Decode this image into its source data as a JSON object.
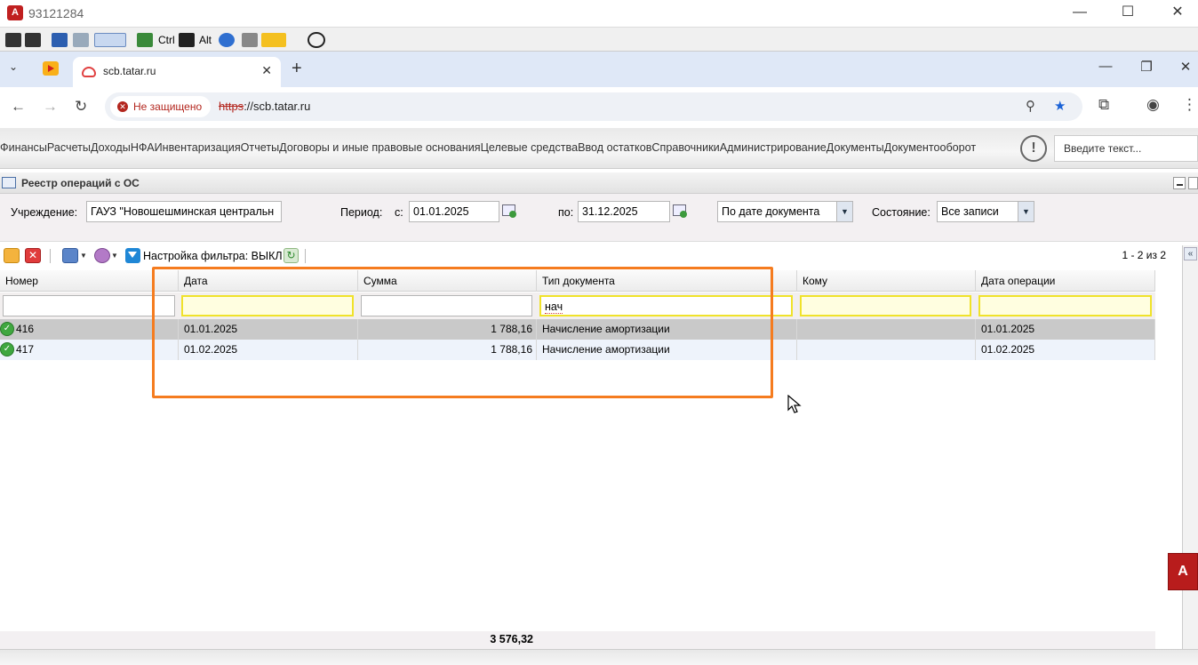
{
  "remote_window": {
    "title": "93121284",
    "controls": {
      "minimize": "—",
      "maximize": "☐",
      "close": "✕"
    }
  },
  "remote_toolbar": {
    "ctrl_label": "Ctrl",
    "alt_label": "Alt"
  },
  "browser": {
    "tab_title": "scb.tatar.ru",
    "tab_close": "✕",
    "new_tab": "+",
    "security_label": "Не защищено",
    "url_scheme": "https",
    "url_rest": "://scb.tatar.ru"
  },
  "app_menu": {
    "items": [
      "Финансы",
      "Расчеты",
      "Доходы",
      "НФА",
      "Инвентаризация",
      "Отчеты",
      "Договоры и иные правовые основания",
      "Целевые средства",
      "Ввод остатков",
      "Справочники",
      "Администрирование",
      "Документы",
      "Документооборот"
    ],
    "search_placeholder": "Введите текст..."
  },
  "panel": {
    "title": "Реестр операций с ОС"
  },
  "filters": {
    "institution_label": "Учреждение:",
    "institution_value": "ГАУЗ \"Новошешминская центральн",
    "period_label": "Период:",
    "from_label": "с:",
    "from_value": "01.01.2025",
    "to_label": "по:",
    "to_value": "31.12.2025",
    "date_mode": "По дате документа",
    "state_label": "Состояние:",
    "state_value": "Все записи"
  },
  "grid_toolbar": {
    "filter_setting": "Настройка фильтра: ВЫКЛ",
    "paging": "1 - 2 из 2"
  },
  "grid": {
    "columns": [
      "Номер",
      "Дата",
      "Сумма",
      "Тип документа",
      "Кому",
      "Дата операции"
    ],
    "filter_values": [
      "",
      "",
      "",
      "нач",
      "",
      ""
    ],
    "rows": [
      {
        "number": "416",
        "date": "01.01.2025",
        "sum": "1 788,16",
        "doc_type": "Начисление амортизации",
        "to": "",
        "op_date": "01.01.2025"
      },
      {
        "number": "417",
        "date": "01.02.2025",
        "sum": "1 788,16",
        "doc_type": "Начисление амортизации",
        "to": "",
        "op_date": "01.02.2025"
      }
    ],
    "total_sum": "3 576,32"
  },
  "colors": {
    "highlight": "#f57c1f",
    "filter_highlight": "#f0e22a",
    "insecure": "#b3261e"
  }
}
